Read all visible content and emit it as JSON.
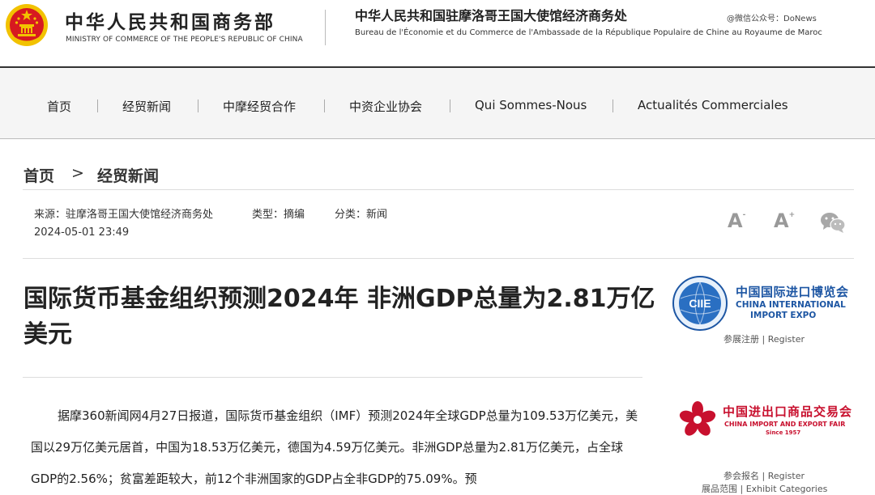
{
  "header": {
    "ministry_cn": "中华人民共和国商务部",
    "ministry_en": "MINISTRY OF COMMERCE OF THE PEOPLE'S REPUBLIC OF CHINA",
    "embassy_cn": "中华人民共和国驻摩洛哥王国大使馆经济商务处",
    "embassy_fr": "Bureau de l'Économie et du Commerce de l'Ambassade de la République Populaire de Chine au Royaume de Maroc",
    "watermark": "@微信公众号：DoNews"
  },
  "nav": {
    "items": [
      "首页",
      "经贸新闻",
      "中摩经贸合作",
      "中资企业协会",
      "Qui Sommes-Nous",
      "Actualités Commerciales"
    ]
  },
  "breadcrumb": {
    "home": "首页",
    "separator": ">",
    "current": "经贸新闻"
  },
  "meta": {
    "source": "来源：驻摩洛哥王国大使馆经济商务处",
    "type": "类型：摘编",
    "category": "分类：新闻",
    "date": "2024-05-01 23:49"
  },
  "tools": {
    "font_decrease": "A",
    "font_decrease_sign": "-",
    "font_increase": "A",
    "font_increase_sign": "+"
  },
  "article": {
    "title": "国际货币基金组织预测2024年 非洲GDP总量为2.81万亿美元",
    "body": "据摩360新闻网4月27日报道，国际货币基金组织（IMF）预测2024年全球GDP总量为109.53万亿美元，美国以29万亿美元居首，中国为18.53万亿美元，德国为4.59万亿美元。非洲GDP总量为2.81万亿美元，占全球GDP的2.56%；贫富差距较大，前12个非洲国家的GDP占全非GDP的75.09%。预"
  },
  "sidebar": {
    "ciie": {
      "logo_text": "CIIE",
      "name_cn": "中国国际进口博览会",
      "name_en_line1": "CHINA INTERNATIONAL",
      "name_en_line2": "IMPORT EXPO",
      "link": "参展注册 | Register"
    },
    "cief": {
      "name_cn": "中国进出口商品交易会",
      "name_en": "CHINA IMPORT AND EXPORT FAIR",
      "since": "Since 1957",
      "link1": "参会报名 | Register",
      "link2": "展品范围 | Exhibit Categories"
    }
  },
  "colors": {
    "ciie_blue": "#1d56a3",
    "cief_red": "#c8102e",
    "nav_bg": "#f5f5f5",
    "emblem_red": "#d71920",
    "emblem_gold": "#f2c200"
  },
  "icons": [
    "national-emblem-icon",
    "wechat-share-icon",
    "ciie-globe-icon",
    "canton-fair-flower-icon"
  ]
}
